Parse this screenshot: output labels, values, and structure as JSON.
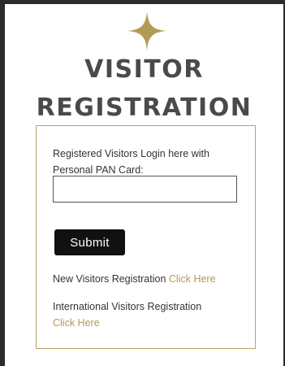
{
  "header": {
    "star_icon": "four-point-star-icon",
    "title_line1": "VISITOR",
    "title_line2": "REGISTRATION"
  },
  "login": {
    "prompt": "Registered Visitors Login here with Personal PAN Card:",
    "pan_value": "",
    "submit_label": "Submit"
  },
  "links": {
    "new_visitors_text": "New Visitors Registration",
    "new_visitors_link": "Click Here",
    "international_text": "International Visitors Registration",
    "international_link": "Click Here"
  },
  "colors": {
    "accent_gold": "#b39a55",
    "card_border": "#b9a46a",
    "title_gray": "#4a4a4a",
    "button_black": "#111111",
    "window_frame": "#2b2b2b"
  }
}
